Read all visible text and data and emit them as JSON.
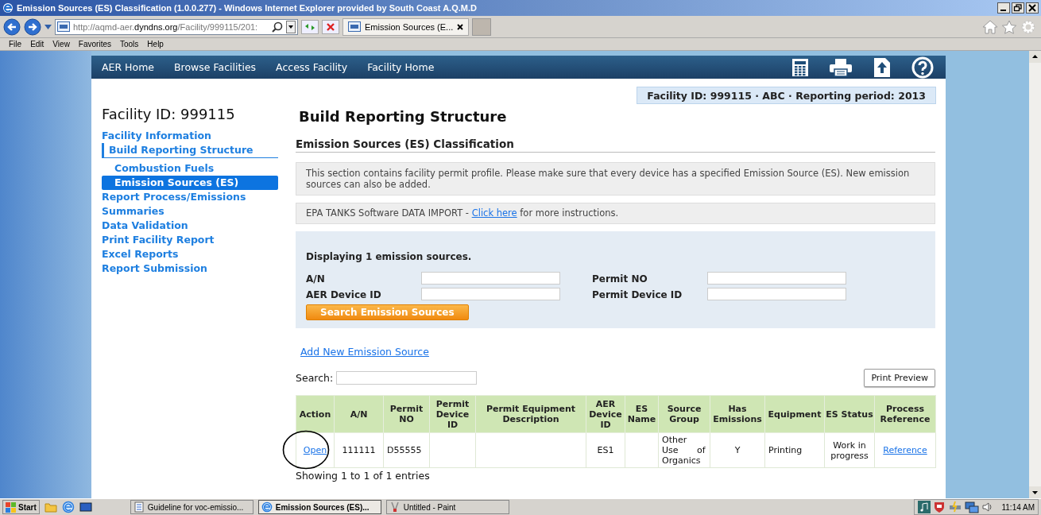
{
  "window": {
    "title": "Emission Sources (ES) Classification (1.0.0.277) - Windows Internet Explorer provided by South Coast A.Q.M.D"
  },
  "browser": {
    "address": {
      "prefix": "http://aqmd-aer.",
      "domain": "dyndns.org",
      "path": "/Facility/999115/201:"
    },
    "tab": "Emission Sources (E...",
    "menu": [
      "File",
      "Edit",
      "View",
      "Favorites",
      "Tools",
      "Help"
    ]
  },
  "nav": {
    "items": [
      "AER Home",
      "Browse Facilities",
      "Access Facility",
      "Facility Home"
    ]
  },
  "banner": "Facility ID: 999115 · ABC · Reporting period: 2013",
  "sidebar": {
    "heading": "Facility ID: 999115",
    "items": [
      {
        "label": "Facility Information",
        "selected": false,
        "expanded": false
      },
      {
        "label": "Build Reporting Structure",
        "selected": false,
        "expanded": true,
        "children": [
          {
            "label": "Combustion Fuels",
            "selected": false
          },
          {
            "label": "Emission Sources (ES)",
            "selected": true
          }
        ]
      },
      {
        "label": "Report Process/Emissions",
        "selected": false,
        "expanded": false
      },
      {
        "label": "Summaries",
        "selected": false,
        "expanded": false
      },
      {
        "label": "Data Validation",
        "selected": false,
        "expanded": false
      },
      {
        "label": "Print Facility Report",
        "selected": false,
        "expanded": false
      },
      {
        "label": "Excel Reports",
        "selected": false,
        "expanded": false
      },
      {
        "label": "Report Submission",
        "selected": false,
        "expanded": false
      }
    ]
  },
  "main": {
    "heading": "Build Reporting Structure",
    "subheading": "Emission Sources (ES) Classification",
    "info": "This section contains facility permit profile. Please make sure that every device has a specified Emission Source (ES). New emission sources can also be added.",
    "import": {
      "before": "EPA TANKS Software DATA IMPORT - ",
      "link": "Click here",
      "after": " for more instructions."
    },
    "search_panel": {
      "count": "Displaying 1 emission sources.",
      "fields": [
        {
          "label": "A/N"
        },
        {
          "label": "Permit NO"
        },
        {
          "label": "AER Device ID"
        },
        {
          "label": "Permit Device ID"
        }
      ],
      "button": "Search Emission Sources"
    },
    "add_link": "Add New Emission Source",
    "search_label": "Search:",
    "print_button": "Print Preview",
    "table": {
      "columns": [
        "Action",
        "A/N",
        "Permit NO",
        "Permit Device ID",
        "Permit Equipment Description",
        "AER Device ID",
        "ES Name",
        "Source Group",
        "Has Emissions",
        "Equipment",
        "ES Status",
        "Process Reference"
      ],
      "rows": [
        {
          "circled": true,
          "cells": [
            {
              "kind": "link",
              "text": "Open"
            },
            {
              "kind": "text",
              "text": "111111"
            },
            {
              "kind": "text",
              "text": "D55555"
            },
            {
              "kind": "empty"
            },
            {
              "kind": "empty"
            },
            {
              "kind": "text",
              "text": "ES1"
            },
            {
              "kind": "empty"
            },
            {
              "kind": "text",
              "text": "Other Use of Organics"
            },
            {
              "kind": "text",
              "text": "Y"
            },
            {
              "kind": "text",
              "text": "Printing"
            },
            {
              "kind": "text",
              "text": "Work in progress"
            },
            {
              "kind": "link",
              "text": "Reference"
            }
          ]
        }
      ]
    },
    "entries": "Showing 1 to 1 of 1 entries"
  },
  "taskbar": {
    "start": "Start",
    "tasks": [
      {
        "label": "Guideline for voc-emissio...",
        "selected": false,
        "kind": "document"
      },
      {
        "label": "Emission Sources (ES)...",
        "selected": true,
        "kind": "browser"
      },
      {
        "label": "Untitled - Paint",
        "selected": false,
        "kind": "paint"
      }
    ],
    "clock": "11:14 AM"
  }
}
